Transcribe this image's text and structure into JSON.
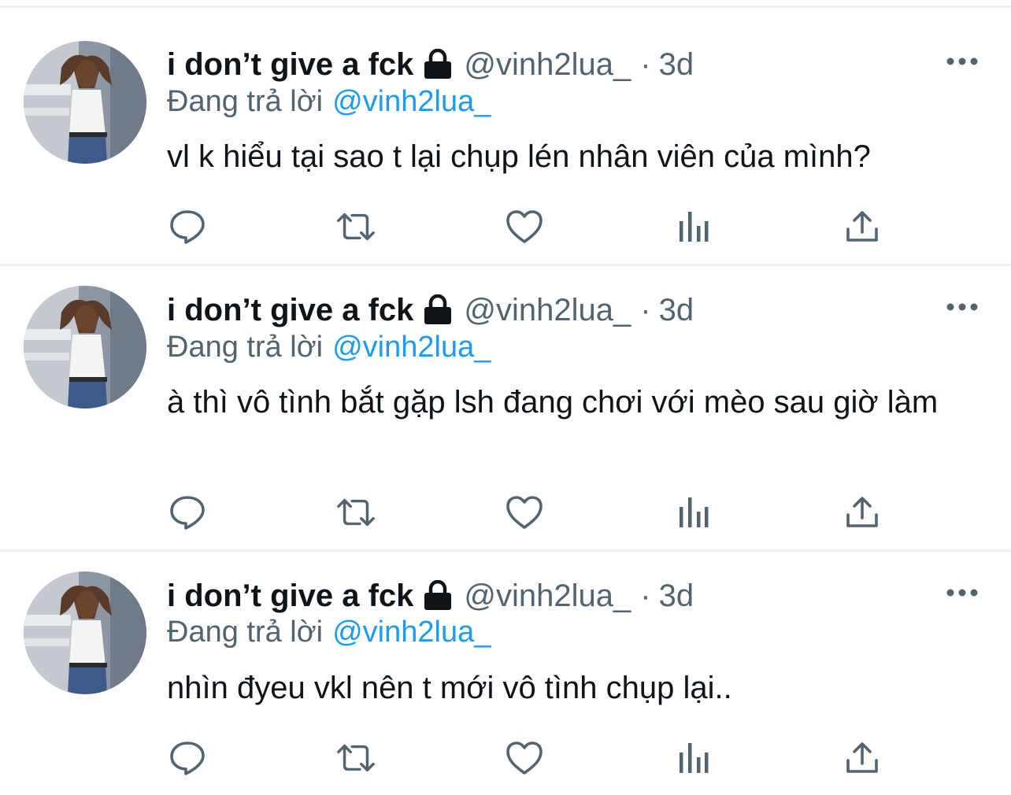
{
  "colors": {
    "text": "#0f1419",
    "secondary": "#536471",
    "link": "#1d9bf0",
    "divider": "#eff3f4"
  },
  "icons": [
    "lock-icon",
    "more-icon",
    "reply-icon",
    "retweet-icon",
    "like-icon",
    "analytics-icon",
    "share-icon"
  ],
  "tweets": [
    {
      "name": "i don’t give a fck",
      "handle": "@vinh2lua_",
      "separator": "·",
      "time": "3d",
      "replying_prefix": "Đang trả lời",
      "replying_to": "@vinh2lua_",
      "text": "vl k hiểu tại sao t lại chụp lén nhân viên của mình?"
    },
    {
      "name": "i don’t give a fck",
      "handle": "@vinh2lua_",
      "separator": "·",
      "time": "3d",
      "replying_prefix": "Đang trả lời",
      "replying_to": "@vinh2lua_",
      "text": "à thì vô tình bắt gặp lsh đang chơi với mèo sau giờ làm"
    },
    {
      "name": "i don’t give a fck",
      "handle": "@vinh2lua_",
      "separator": "·",
      "time": "3d",
      "replying_prefix": "Đang trả lời",
      "replying_to": "@vinh2lua_",
      "text": "nhìn đyeu vkl nên t mới vô tình chụp lại.."
    }
  ]
}
